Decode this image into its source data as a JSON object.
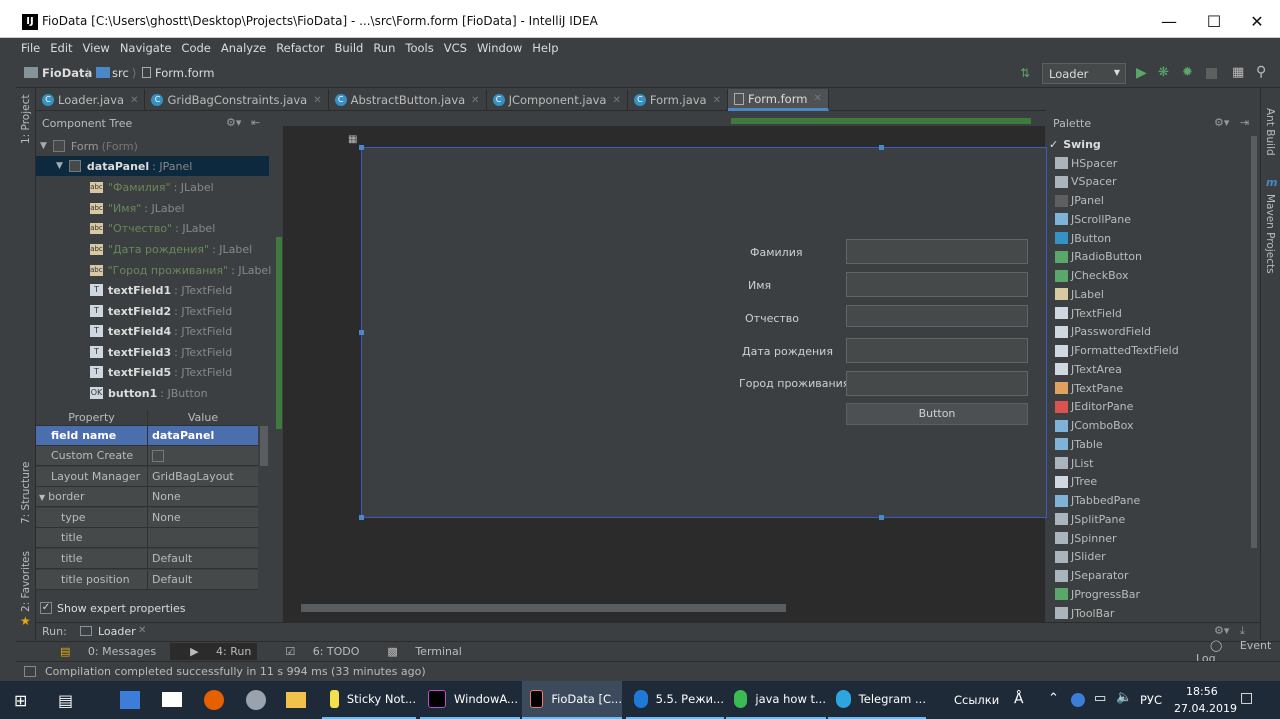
{
  "window": {
    "title": "FioData [C:\\Users\\ghostt\\Desktop\\Projects\\FioData] - ...\\src\\Form.form [FioData] - IntelliJ IDEA"
  },
  "menu": [
    "File",
    "Edit",
    "View",
    "Navigate",
    "Code",
    "Analyze",
    "Refactor",
    "Build",
    "Run",
    "Tools",
    "VCS",
    "Window",
    "Help"
  ],
  "breadcrumbs": [
    "FioData",
    "src",
    "Form.form"
  ],
  "run_config": "Loader",
  "tabs": [
    {
      "label": "Loader.java"
    },
    {
      "label": "GridBagConstraints.java"
    },
    {
      "label": "AbstractButton.java"
    },
    {
      "label": "JComponent.java"
    },
    {
      "label": "Form.java"
    },
    {
      "label": "Form.form",
      "active": true
    }
  ],
  "left_strip": {
    "project": "1: Project",
    "structure": "7: Structure",
    "favorites": "2: Favorites"
  },
  "right_strip": {
    "ant": "Ant Build",
    "maven": "Maven Projects"
  },
  "component_tree": {
    "title": "Component Tree",
    "root": {
      "name": "Form",
      "type": "(Form)"
    },
    "panel": {
      "name": "dataPanel",
      "type": ": JPanel"
    },
    "labels": [
      {
        "text": "\"Фамилия\"",
        "type": ": JLabel"
      },
      {
        "text": "\"Имя\"",
        "type": ": JLabel"
      },
      {
        "text": "\"Отчество\"",
        "type": ": JLabel"
      },
      {
        "text": "\"Дата рождения\"",
        "type": ": JLabel"
      },
      {
        "text": "\"Город проживания\"",
        "type": ": JLabel"
      }
    ],
    "fields": [
      {
        "name": "textField1",
        "type": ": JTextField"
      },
      {
        "name": "textField2",
        "type": ": JTextField"
      },
      {
        "name": "textField4",
        "type": ": JTextField"
      },
      {
        "name": "textField3",
        "type": ": JTextField"
      },
      {
        "name": "textField5",
        "type": ": JTextField"
      }
    ],
    "button": {
      "name": "button1",
      "type": ": JButton"
    }
  },
  "properties": {
    "header": {
      "property": "Property",
      "value": "Value"
    },
    "rows": [
      {
        "key": "field name",
        "value": "dataPanel",
        "selected": true
      },
      {
        "key": "Custom Create",
        "value": ""
      },
      {
        "key": "Layout Manager",
        "value": "GridBagLayout"
      },
      {
        "key": "border",
        "value": "None"
      },
      {
        "key": "type",
        "value": "None"
      },
      {
        "key": "title",
        "value": ""
      },
      {
        "key": "title justification",
        "value": "Default"
      },
      {
        "key": "title position",
        "value": "Default"
      }
    ],
    "expert": "Show expert properties"
  },
  "form": {
    "labels": [
      "Фамилия",
      "Имя",
      "Отчество",
      "Дата рождения",
      "Город проживания"
    ],
    "button": "Button"
  },
  "palette": {
    "title": "Palette",
    "group": "Swing",
    "items": [
      "HSpacer",
      "VSpacer",
      "JPanel",
      "JScrollPane",
      "JButton",
      "JRadioButton",
      "JCheckBox",
      "JLabel",
      "JTextField",
      "JPasswordField",
      "JFormattedTextField",
      "JTextArea",
      "JTextPane",
      "JEditorPane",
      "JComboBox",
      "JTable",
      "JList",
      "JTree",
      "JTabbedPane",
      "JSplitPane",
      "JSpinner",
      "JSlider",
      "JSeparator",
      "JProgressBar",
      "JToolBar"
    ]
  },
  "run_bar": {
    "label": "Run:",
    "config": "Loader"
  },
  "bottom_tools": [
    "0: Messages",
    "4: Run",
    "6: TODO",
    "Terminal"
  ],
  "event_log": "Event Log",
  "status": "Compilation completed successfully in 11 s 994 ms (33 minutes ago)",
  "taskbar": {
    "items": [
      "Sticky Not...",
      "WindowA...",
      "FioData [C...",
      "5.5. Режи...",
      "java how t...",
      "Telegram ..."
    ],
    "links": "Ссылки",
    "lang": "РУС",
    "time": "18:56",
    "date": "27.04.2019"
  }
}
